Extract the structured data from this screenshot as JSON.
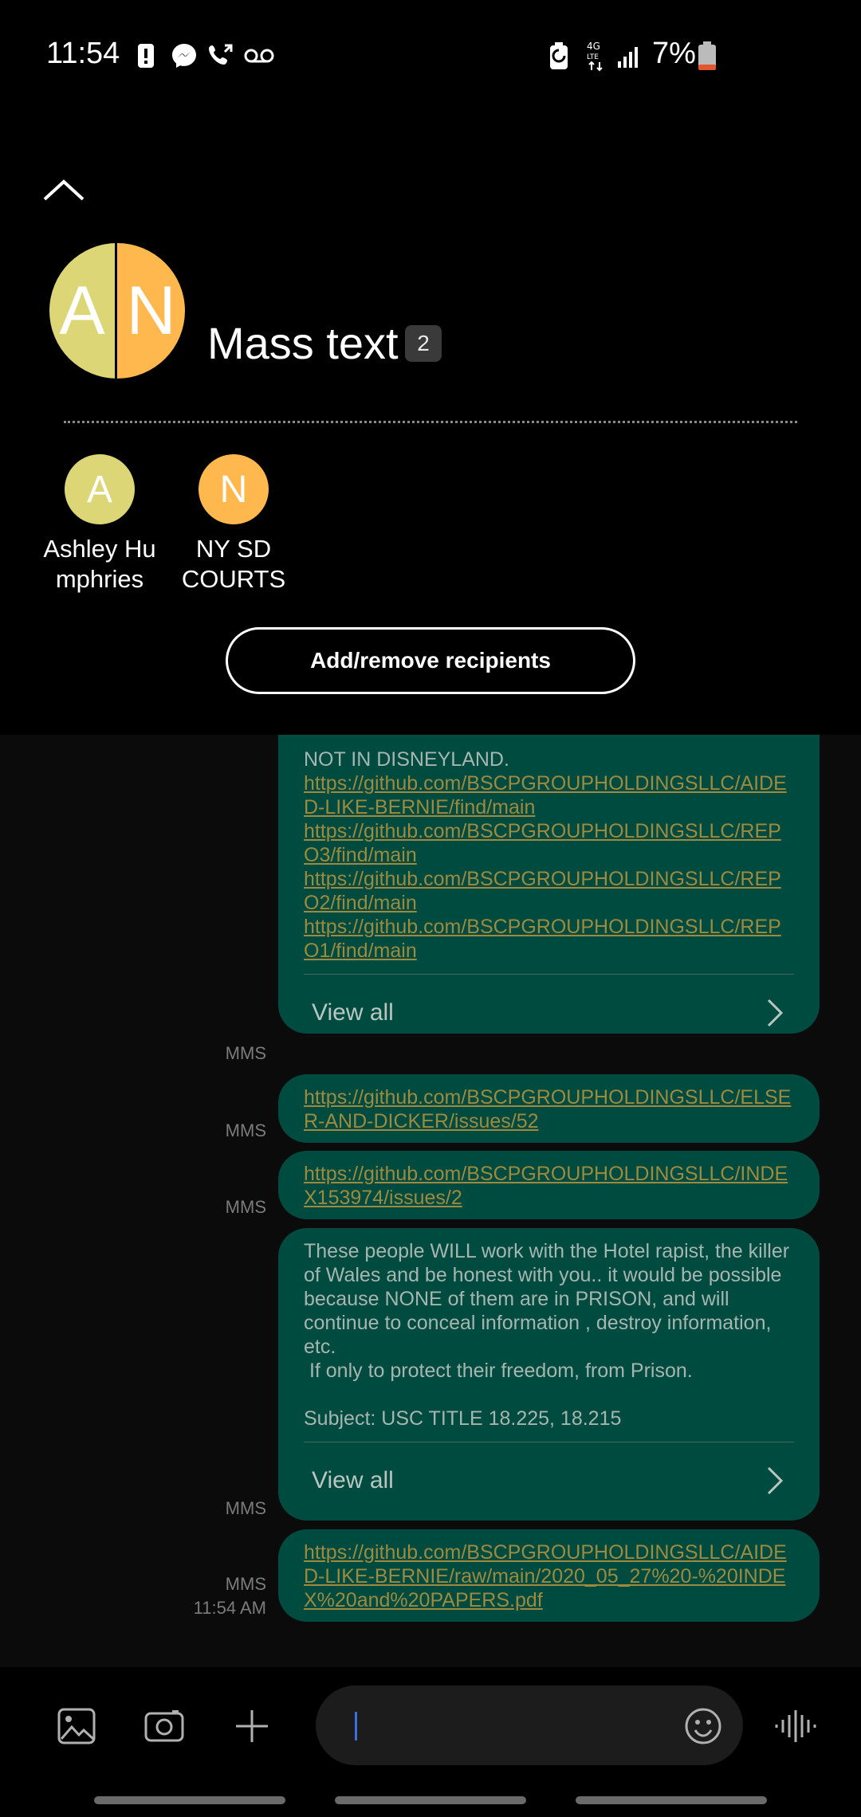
{
  "status_bar": {
    "time": "11:54",
    "battery_percent": "7%",
    "icons": [
      "alert-icon",
      "messenger-icon",
      "call-forward-icon",
      "voicemail-icon",
      "battery-saver-icon",
      "4g-lte-icon",
      "signal-icon",
      "battery-low-icon"
    ]
  },
  "header": {
    "group_title": "Mass text",
    "recipient_count": "2",
    "avatar_letters": [
      "A",
      "N"
    ],
    "add_remove_label": "Add/remove recipients"
  },
  "recipients": [
    {
      "initial": "A",
      "name_line1": "Ashley Hu",
      "name_line2": "mphries",
      "color": "#dcd676"
    },
    {
      "initial": "N",
      "name_line1": "NY SD",
      "name_line2": "COURTS",
      "color": "#ffb84d"
    }
  ],
  "messages": [
    {
      "type": "MMS",
      "text": "NOT IN DISNEYLAND.",
      "links": [
        "https://github.com/BSCPGROUPHOLDINGSLLC/AIDED-LIKE-BERNIE/find/main",
        "https://github.com/BSCPGROUPHOLDINGSLLC/REPO3/find/main",
        "https://github.com/BSCPGROUPHOLDINGSLLC/REPO2/find/main",
        "https://github.com/BSCPGROUPHOLDINGSLLC/REPO1/find/main"
      ],
      "view_all": "View all"
    },
    {
      "type": "MMS",
      "link": "https://github.com/BSCPGROUPHOLDINGSLLC/ELSER-AND-DICKER/issues/52"
    },
    {
      "type": "MMS",
      "link": "https://github.com/BSCPGROUPHOLDINGSLLC/INDEX153974/issues/2"
    },
    {
      "type": "MMS",
      "text": "These people WILL work with the Hotel rapist, the killer of Wales and be honest with you.. it would be possible because NONE of them are in PRISON, and will continue to conceal information , destroy information, etc.",
      "text2": " If only to protect their freedom, from Prison.",
      "subject": "Subject: USC TITLE 18.225, 18.215",
      "view_all": "View all"
    },
    {
      "type": "MMS",
      "time": "11:54 AM",
      "link": "https://github.com/BSCPGROUPHOLDINGSLLC/AIDED-LIKE-BERNIE/raw/main/2020_05_27%20-%20INDEX%20and%20PAPERS.pdf"
    }
  ],
  "colors": {
    "bubble": "#004b40",
    "link": "#9d8a3e",
    "caret": "#3b6fe0"
  }
}
